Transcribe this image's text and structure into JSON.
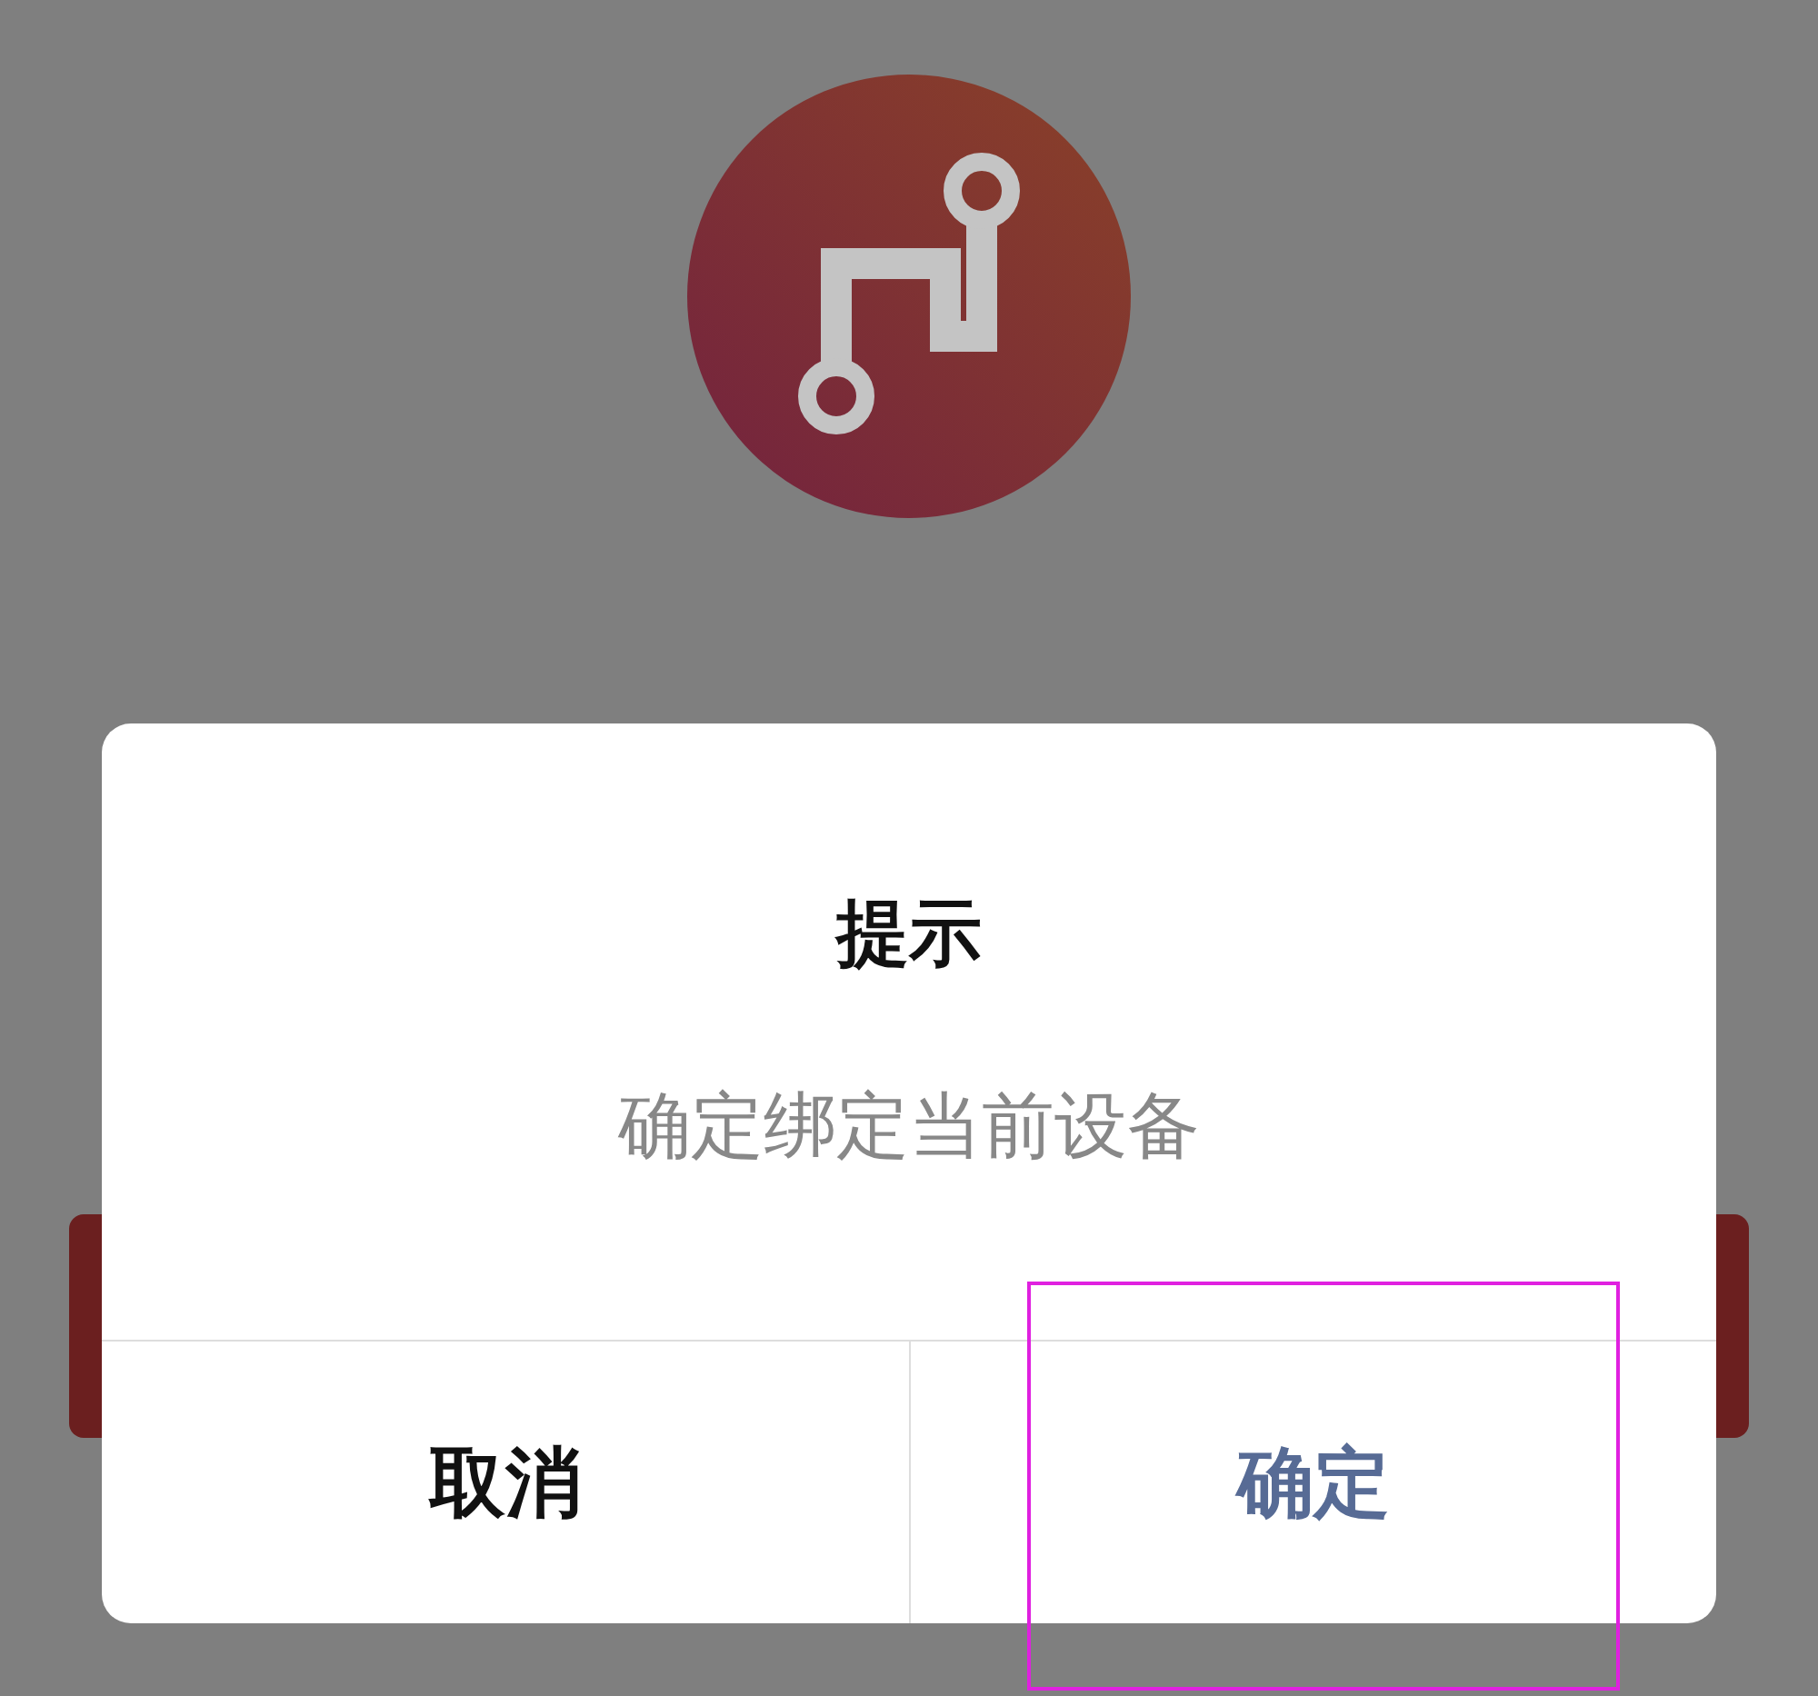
{
  "dialog": {
    "title": "提示",
    "message": "确定绑定当前设备",
    "buttons": [
      {
        "label": "取消",
        "kind": "cancel"
      },
      {
        "label": "确定",
        "kind": "confirm"
      }
    ]
  }
}
